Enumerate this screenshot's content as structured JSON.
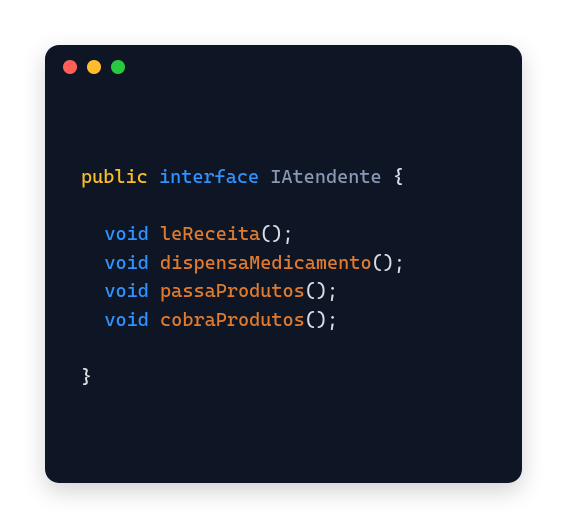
{
  "window": {
    "traffic_colors": {
      "red": "#ff5f56",
      "yellow": "#ffbd2e",
      "green": "#27c93f"
    },
    "background": "#0e1524"
  },
  "code": {
    "language": "java",
    "keywords": {
      "public": "public",
      "interface": "interface",
      "void": "void"
    },
    "type_name": "IAtendente",
    "open_brace": "{",
    "close_brace": "}",
    "paren_pair": "();",
    "space": " ",
    "methods": [
      "leReceita",
      "dispensaMedicamento",
      "passaProdutos",
      "cobraProdutos"
    ]
  }
}
